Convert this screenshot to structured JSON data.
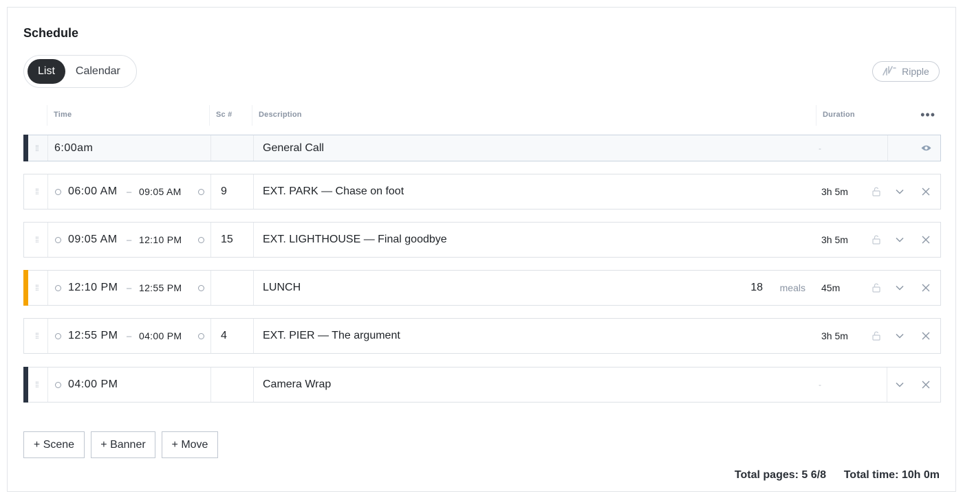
{
  "title": "Schedule",
  "view_toggle": {
    "list": "List",
    "calendar": "Calendar"
  },
  "ripple_label": "Ripple",
  "columns": {
    "time": "Time",
    "scene": "Sc #",
    "description": "Description",
    "duration": "Duration"
  },
  "banner": {
    "time": "6:00am",
    "description": "General Call",
    "duration": "-"
  },
  "rows": [
    {
      "start": "06:00 AM",
      "dash": "–",
      "end": "09:05 AM",
      "scene": "9",
      "description": "EXT. PARK — Chase on foot",
      "duration": "3h 5m"
    },
    {
      "start": "09:05 AM",
      "dash": "–",
      "end": "12:10 PM",
      "scene": "15",
      "description": "EXT. LIGHTHOUSE — Final goodbye",
      "duration": "3h 5m"
    },
    {
      "start": "12:10 PM",
      "dash": "–",
      "end": "12:55 PM",
      "scene": "",
      "description": "LUNCH",
      "meals_count": "18",
      "meals_label": "meals",
      "duration": "45m",
      "accent": "#f5a300"
    },
    {
      "start": "12:55 PM",
      "dash": "–",
      "end": "04:00 PM",
      "scene": "4",
      "description": "EXT. PIER — The argument",
      "duration": "3h 5m"
    },
    {
      "start": "04:00 PM",
      "description": "Camera Wrap",
      "duration": "-",
      "accent": "#2a3342"
    }
  ],
  "add_buttons": {
    "scene": "+ Scene",
    "banner": "+ Banner",
    "move": "+ Move"
  },
  "totals": {
    "pages": "Total pages: 5 6/8",
    "time": "Total time: 10h 0m"
  },
  "colors": {
    "dark_accent": "#2a3342",
    "lunch_accent": "#f5a300"
  },
  "icons": [
    "drag-handle-icon",
    "eye-icon",
    "lock-icon",
    "chevron-down-icon",
    "close-icon",
    "more-icon",
    "ripple-icon"
  ]
}
